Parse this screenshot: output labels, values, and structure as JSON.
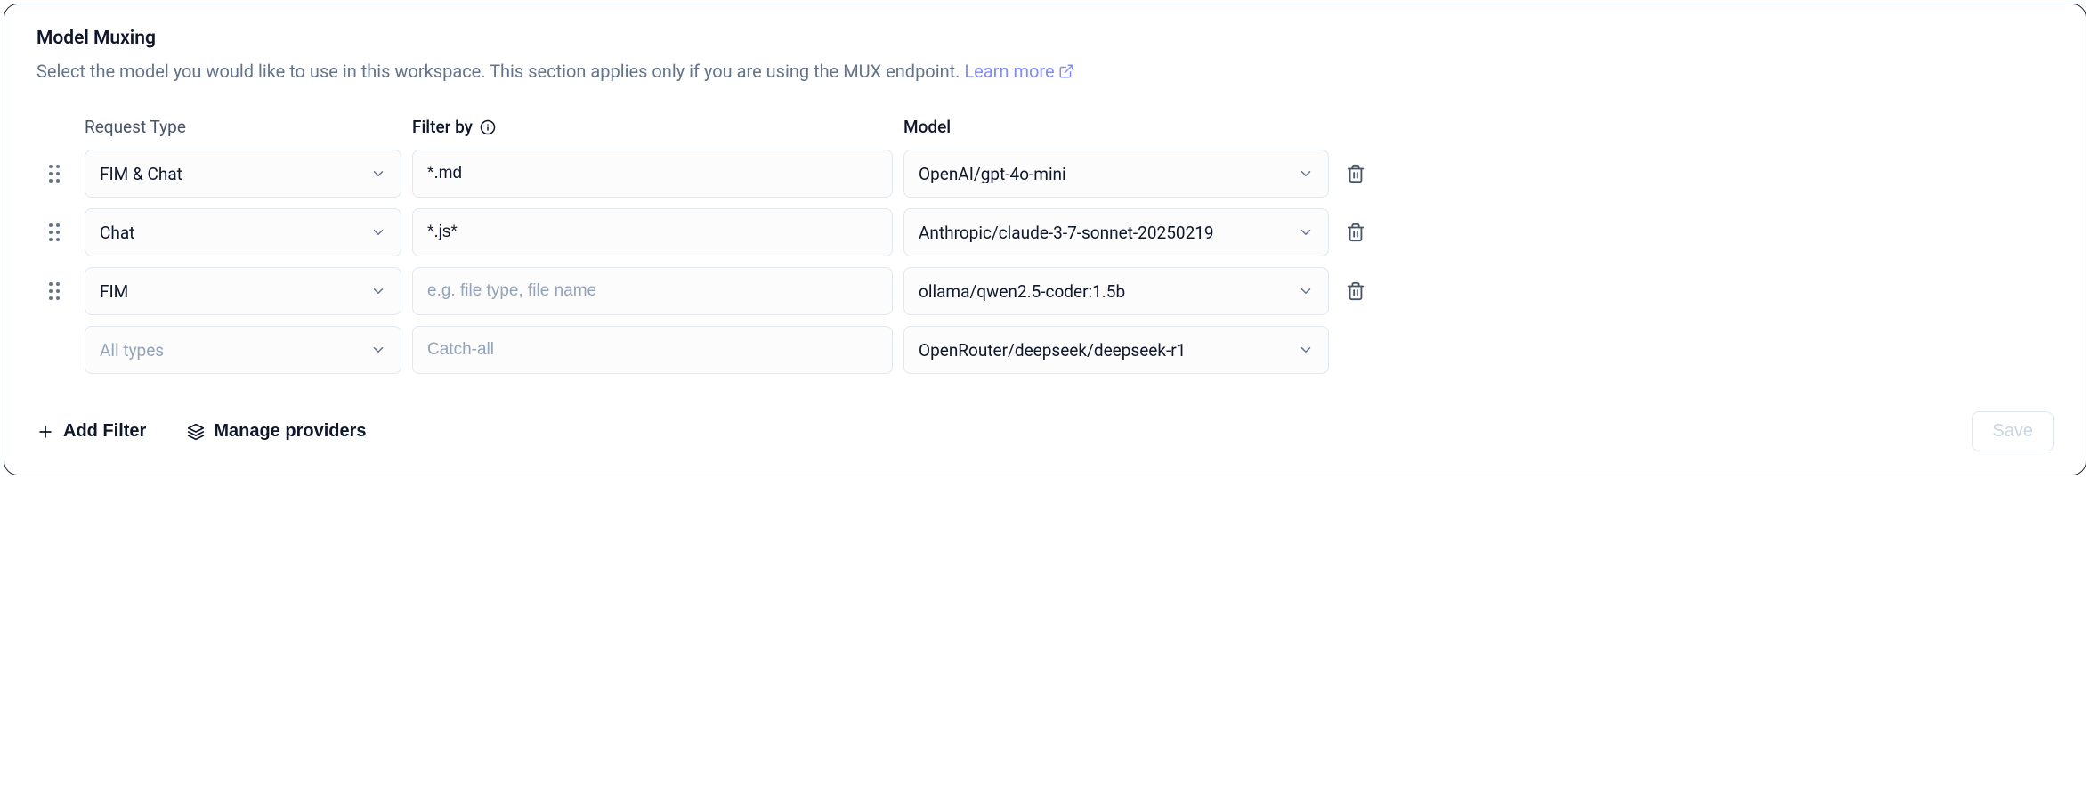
{
  "panel": {
    "title": "Model Muxing",
    "description": "Select the model you would like to use in this workspace. This section applies only if you are using the MUX endpoint. ",
    "learn_more": "Learn more"
  },
  "headers": {
    "request_type": "Request Type",
    "filter_by": "Filter by",
    "model": "Model"
  },
  "rows": [
    {
      "request_type": "FIM & Chat",
      "filter": "*.md",
      "filter_placeholder": "",
      "model": "OpenAI/gpt-4o-mini",
      "deletable": true,
      "draggable": true,
      "type_disabled": false,
      "filter_disabled": false
    },
    {
      "request_type": "Chat",
      "filter": "*.js*",
      "filter_placeholder": "",
      "model": "Anthropic/claude-3-7-sonnet-20250219",
      "deletable": true,
      "draggable": true,
      "type_disabled": false,
      "filter_disabled": false
    },
    {
      "request_type": "FIM",
      "filter": "",
      "filter_placeholder": "e.g. file type, file name",
      "model": "ollama/qwen2.5-coder:1.5b",
      "deletable": true,
      "draggable": true,
      "type_disabled": false,
      "filter_disabled": false
    },
    {
      "request_type": "All types",
      "filter": "",
      "filter_placeholder": "Catch-all",
      "model": "OpenRouter/deepseek/deepseek-r1",
      "deletable": false,
      "draggable": false,
      "type_disabled": true,
      "filter_disabled": true
    }
  ],
  "footer": {
    "add_filter": "Add Filter",
    "manage_providers": "Manage providers",
    "save": "Save"
  }
}
